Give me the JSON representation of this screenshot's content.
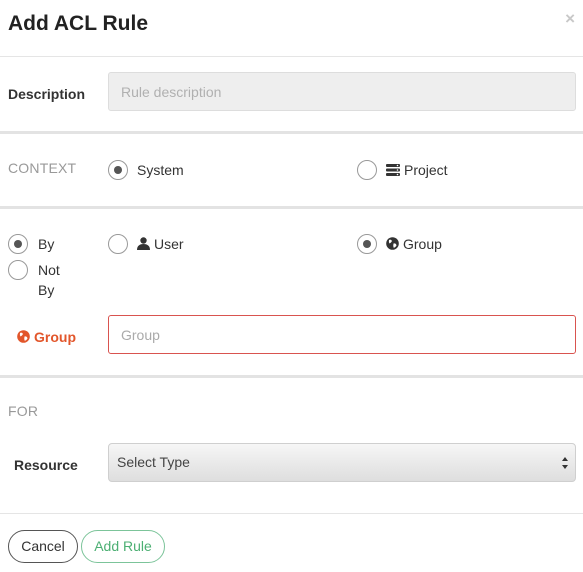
{
  "dialog": {
    "title": "Add ACL Rule",
    "close_glyph": "×"
  },
  "description": {
    "label": "Description",
    "placeholder": "Rule description",
    "value": ""
  },
  "context": {
    "label": "CONTEXT",
    "options": [
      {
        "label": "System",
        "icon": null,
        "checked": true
      },
      {
        "label": "Project",
        "icon": "list-icon",
        "checked": false
      }
    ]
  },
  "match": {
    "options": [
      {
        "label": "By",
        "checked": true
      },
      {
        "label": "Not By",
        "checked": false
      }
    ]
  },
  "subject": {
    "options": [
      {
        "label": "User",
        "icon": "user-icon",
        "checked": false
      },
      {
        "label": "Group",
        "icon": "globe-icon",
        "checked": true
      }
    ]
  },
  "group_field": {
    "label": "Group",
    "icon": "globe-icon",
    "placeholder": "Group",
    "value": "",
    "error_color": "#e2562b"
  },
  "for_section": {
    "label": "FOR"
  },
  "resource": {
    "label": "Resource",
    "selected": "Select Type"
  },
  "buttons": {
    "cancel": "Cancel",
    "add": "Add Rule"
  },
  "colors": {
    "accent_green": "#4caf73",
    "error": "#d9534f"
  }
}
